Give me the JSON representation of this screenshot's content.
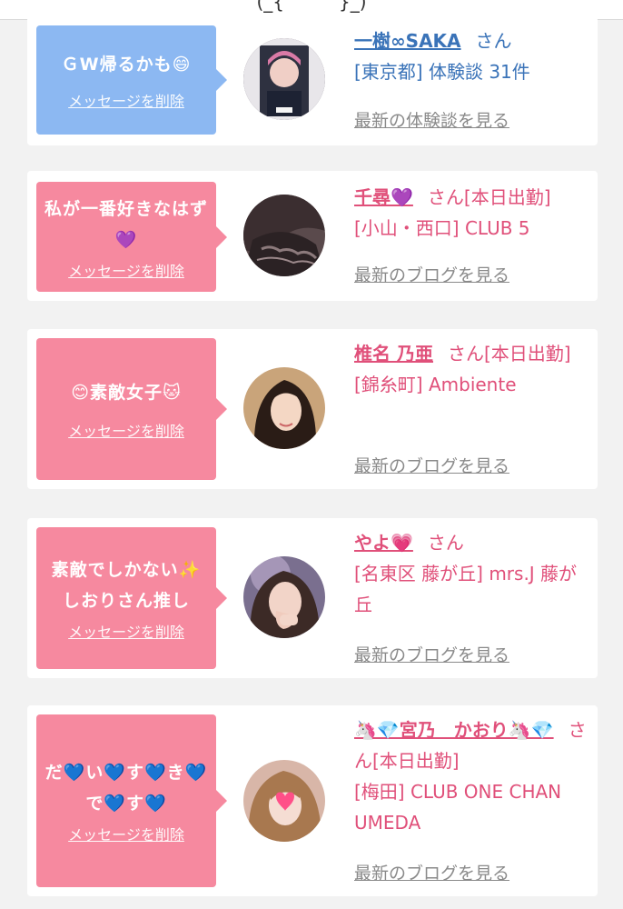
{
  "top": {
    "partial_title": "(_{　　　}_)"
  },
  "colors": {
    "blue_bubble": "#8cb8f2",
    "pink_bubble": "#f6899f",
    "blue_text": "#3a73b8",
    "pink_text": "#e0507a",
    "link_gray": "#8a8a8a"
  },
  "cards": [
    {
      "theme": "blue",
      "message": "ＧW帰るかも😄",
      "delete_label": "メッセージを削除",
      "name": "一樹∞SAKA",
      "suffix": "さん",
      "shop_line": "[東京都] 体験談 31件",
      "latest_link": "最新の体験談を見る"
    },
    {
      "theme": "pink",
      "message": "私が一番好きなはず💜",
      "delete_label": "メッセージを削除",
      "name": "千尋💜",
      "suffix": "さん[本日出勤]",
      "shop_line": "[小山・西口] CLUB 5",
      "latest_link": "最新のブログを見る"
    },
    {
      "theme": "pink",
      "message": "😊素敵女子🐱",
      "delete_label": "メッセージを削除",
      "name": "椎名 乃亜",
      "suffix": "さん[本日出勤]",
      "shop_line": "[錦糸町] Ambiente",
      "latest_link": "最新のブログを見る"
    },
    {
      "theme": "pink",
      "message": "素敵でしかない✨しおりさん推し",
      "delete_label": "メッセージを削除",
      "name": "やよ💗",
      "suffix": "さん",
      "shop_line": "[名東区 藤が丘] mrs.J 藤が丘",
      "latest_link": "最新のブログを見る"
    },
    {
      "theme": "pink",
      "message": "だ💙い💙す💙き💙で💙す💙",
      "delete_label": "メッセージを削除",
      "name": "🦄💎宮乃　かおり🦄💎",
      "suffix": "さん[本日出勤]",
      "shop_line": "[梅田] CLUB ONE CHAN UMEDA",
      "latest_link": "最新のブログを見る"
    }
  ]
}
